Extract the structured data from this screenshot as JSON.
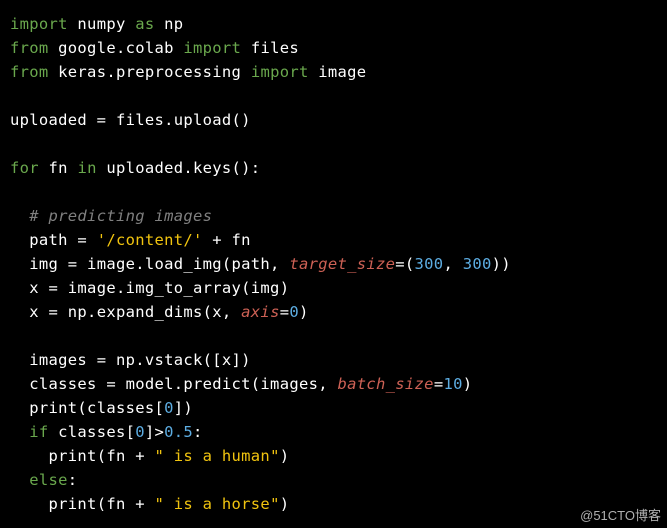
{
  "code": {
    "l1": {
      "kw1": "import",
      "t1": " numpy ",
      "kw2": "as",
      "t2": " np"
    },
    "l2": {
      "kw1": "from",
      "t1": " google.colab ",
      "kw2": "import",
      "t2": " files"
    },
    "l3": {
      "kw1": "from",
      "t1": " keras.preprocessing ",
      "kw2": "import",
      "t2": " image"
    },
    "l4": {
      "blank": ""
    },
    "l5": {
      "t1": "uploaded = files.upload()"
    },
    "l6": {
      "blank": ""
    },
    "l7": {
      "kw1": "for",
      "t1": " fn ",
      "kw2": "in",
      "t2": " uploaded.keys():"
    },
    "l8": {
      "blank": ""
    },
    "l9": {
      "indent": "  ",
      "comment": "# predicting images"
    },
    "l10": {
      "indent": "  ",
      "t1": "path = ",
      "s1": "'/content/'",
      "t2": " + fn"
    },
    "l11": {
      "indent": "  ",
      "t1": "img = image.load_img(path, ",
      "p1": "target_size",
      "t2": "=(",
      "n1": "300",
      "t3": ", ",
      "n2": "300",
      "t4": "))"
    },
    "l12": {
      "indent": "  ",
      "t1": "x = image.img_to_array(img)"
    },
    "l13": {
      "indent": "  ",
      "t1": "x = np.expand_dims(x, ",
      "p1": "axis",
      "t2": "=",
      "n1": "0",
      "t3": ")"
    },
    "l14": {
      "blank": ""
    },
    "l15": {
      "indent": "  ",
      "t1": "images = np.vstack([x])"
    },
    "l16": {
      "indent": "  ",
      "t1": "classes = model.predict(images, ",
      "p1": "batch_size",
      "t2": "=",
      "n1": "10",
      "t3": ")"
    },
    "l17": {
      "indent": "  ",
      "t1": "print(classes[",
      "n1": "0",
      "t2": "])"
    },
    "l18": {
      "indent": "  ",
      "kw1": "if",
      "t1": " classes[",
      "n1": "0",
      "t2": "]>",
      "n2": "0.5",
      "t3": ":"
    },
    "l19": {
      "indent": "    ",
      "t1": "print(fn + ",
      "s1": "\" is a human\"",
      "t2": ")"
    },
    "l20": {
      "indent": "  ",
      "kw1": "else",
      "t1": ":"
    },
    "l21": {
      "indent": "    ",
      "t1": "print(fn + ",
      "s1": "\" is a horse\"",
      "t2": ")"
    }
  },
  "watermark": "@51CTO博客"
}
